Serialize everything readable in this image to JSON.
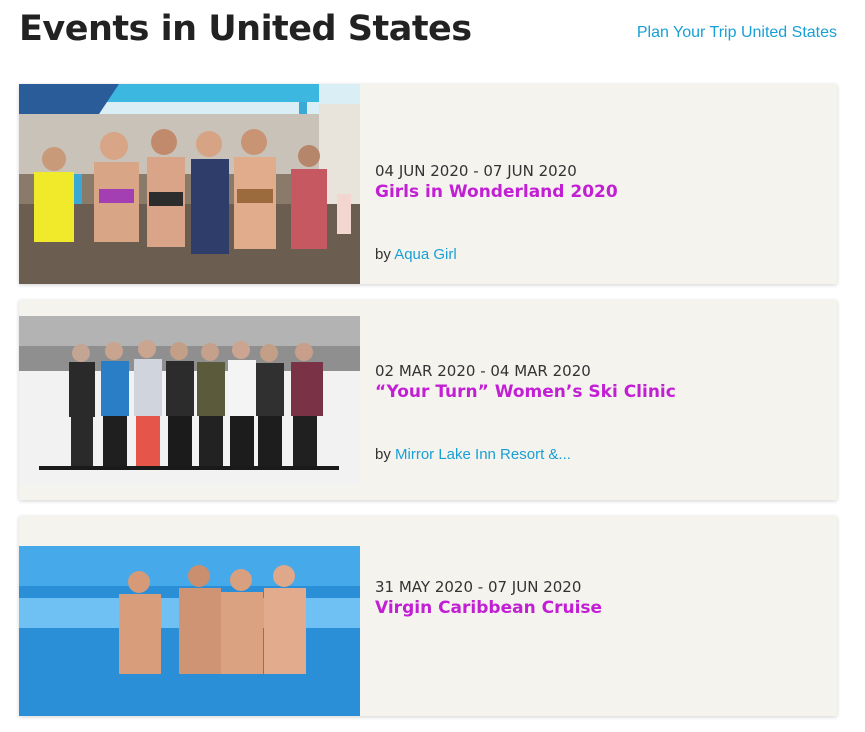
{
  "header": {
    "title": "Events in United States",
    "plan_link": "Plan Your Trip United States"
  },
  "events": [
    {
      "date": "04 JUN 2020 - 07 JUN 2020",
      "title": "Girls in Wonderland 2020",
      "by_label": "by",
      "organizer": "Aqua Girl",
      "image": "group-of-women-in-swimwear-at-tiki-bar"
    },
    {
      "date": "02 MAR 2020 - 04 MAR 2020",
      "title": "“Your Turn” Women’s Ski Clinic",
      "by_label": "by",
      "organizer": "Mirror Lake Inn Resort &...",
      "image": "group-of-women-skiers-on-snowy-slope"
    },
    {
      "date": "31 MAY 2020 - 07 JUN 2020",
      "title": "Virgin Caribbean Cruise",
      "image": "group-of-shirtless-men-on-cruise-deck"
    }
  ]
}
